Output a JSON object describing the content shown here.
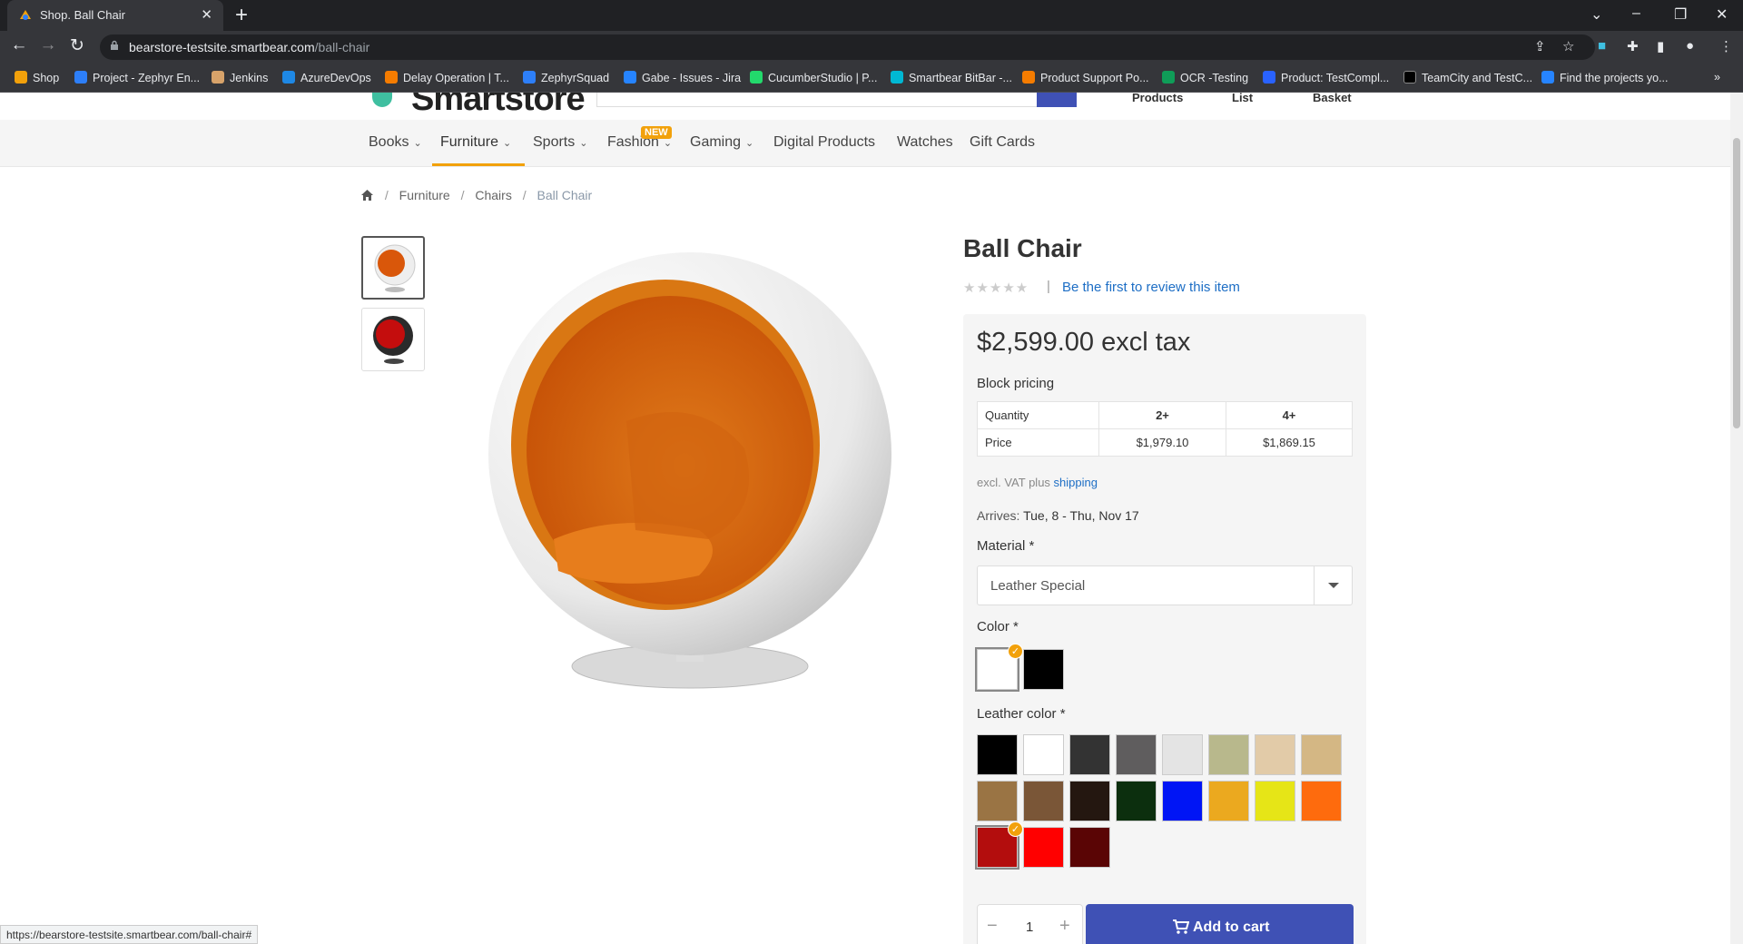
{
  "browser": {
    "tab_title": "Shop. Ball Chair",
    "url_host": "bearstore-testsite.smartbear.com",
    "url_path": "/ball-chair",
    "status_url": "https://bearstore-testsite.smartbear.com/ball-chair#"
  },
  "bookmarks": [
    {
      "label": "Shop",
      "color": "#f2a10b"
    },
    {
      "label": "Project - Zephyr En...",
      "color": "#2d7ff9"
    },
    {
      "label": "Jenkins",
      "color": "#d8a36a"
    },
    {
      "label": "AzureDevOps",
      "color": "#1e88e5"
    },
    {
      "label": "Delay Operation | T...",
      "color": "#f57c00"
    },
    {
      "label": "ZephyrSquad",
      "color": "#2d7ff9"
    },
    {
      "label": "Gabe - Issues - Jira",
      "color": "#2684ff"
    },
    {
      "label": "CucumberStudio | P...",
      "color": "#23d96c"
    },
    {
      "label": "Smartbear BitBar -...",
      "color": "#00b8d4"
    },
    {
      "label": "Product Support Po...",
      "color": "#f57c00"
    },
    {
      "label": "OCR -Testing",
      "color": "#0f9d58"
    },
    {
      "label": "Product: TestCompl...",
      "color": "#2962ff"
    },
    {
      "label": "TeamCity and TestC...",
      "color": "#000000"
    },
    {
      "label": "Find the projects yo...",
      "color": "#2684ff"
    }
  ],
  "header": {
    "logo_text": "Smartstore",
    "links": [
      "Products",
      "List",
      "Basket"
    ]
  },
  "nav": {
    "categories": [
      {
        "label": "Books",
        "has_menu": true
      },
      {
        "label": "Furniture",
        "has_menu": true
      },
      {
        "label": "Sports",
        "has_menu": true
      },
      {
        "label": "Fashion",
        "has_menu": true
      },
      {
        "label": "Gaming",
        "has_menu": true
      },
      {
        "label": "Digital Products",
        "has_menu": false
      },
      {
        "label": "Watches",
        "has_menu": false
      },
      {
        "label": "Gift Cards",
        "has_menu": false
      }
    ],
    "badge": "NEW",
    "active": "Furniture"
  },
  "breadcrumb": [
    "Furniture",
    "Chairs",
    "Ball Chair"
  ],
  "product": {
    "title": "Ball Chair",
    "review_link": "Be the first to review this item",
    "price": "$2,599.00 excl tax",
    "block_pricing_label": "Block pricing",
    "pricing_table": {
      "header": [
        "Quantity",
        "2+",
        "4+"
      ],
      "row": [
        "Price",
        "$1,979.10",
        "$1,869.15"
      ]
    },
    "vat_note_prefix": "excl. VAT plus",
    "vat_note_link": "shipping",
    "arrives_label": "Arrives:",
    "arrives_dates": "Tue, 8 - Thu, Nov 17",
    "material_label": "Material *",
    "material_value": "Leather Special",
    "color_label": "Color *",
    "colors": [
      "#ffffff",
      "#000000"
    ],
    "color_selected": 0,
    "leather_label": "Leather color *",
    "leather_colors": [
      "#000000",
      "#ffffff",
      "#333333",
      "#5f5d5e",
      "#e4e4e4",
      "#b8b88c",
      "#e2cba8",
      "#d4b784",
      "#9a7444",
      "#7a5637",
      "#241710",
      "#0c2f0e",
      "#0015f5",
      "#eba91f",
      "#e6e517",
      "#fe6b0d",
      "#b30d0d",
      "#ff0000",
      "#5a0505"
    ],
    "leather_selected": 16,
    "quantity": "1",
    "add_to_cart": "Add to cart"
  },
  "accent": "#f2a10b",
  "brand": "#3f51b5",
  "link_color": "#1d6ec5"
}
